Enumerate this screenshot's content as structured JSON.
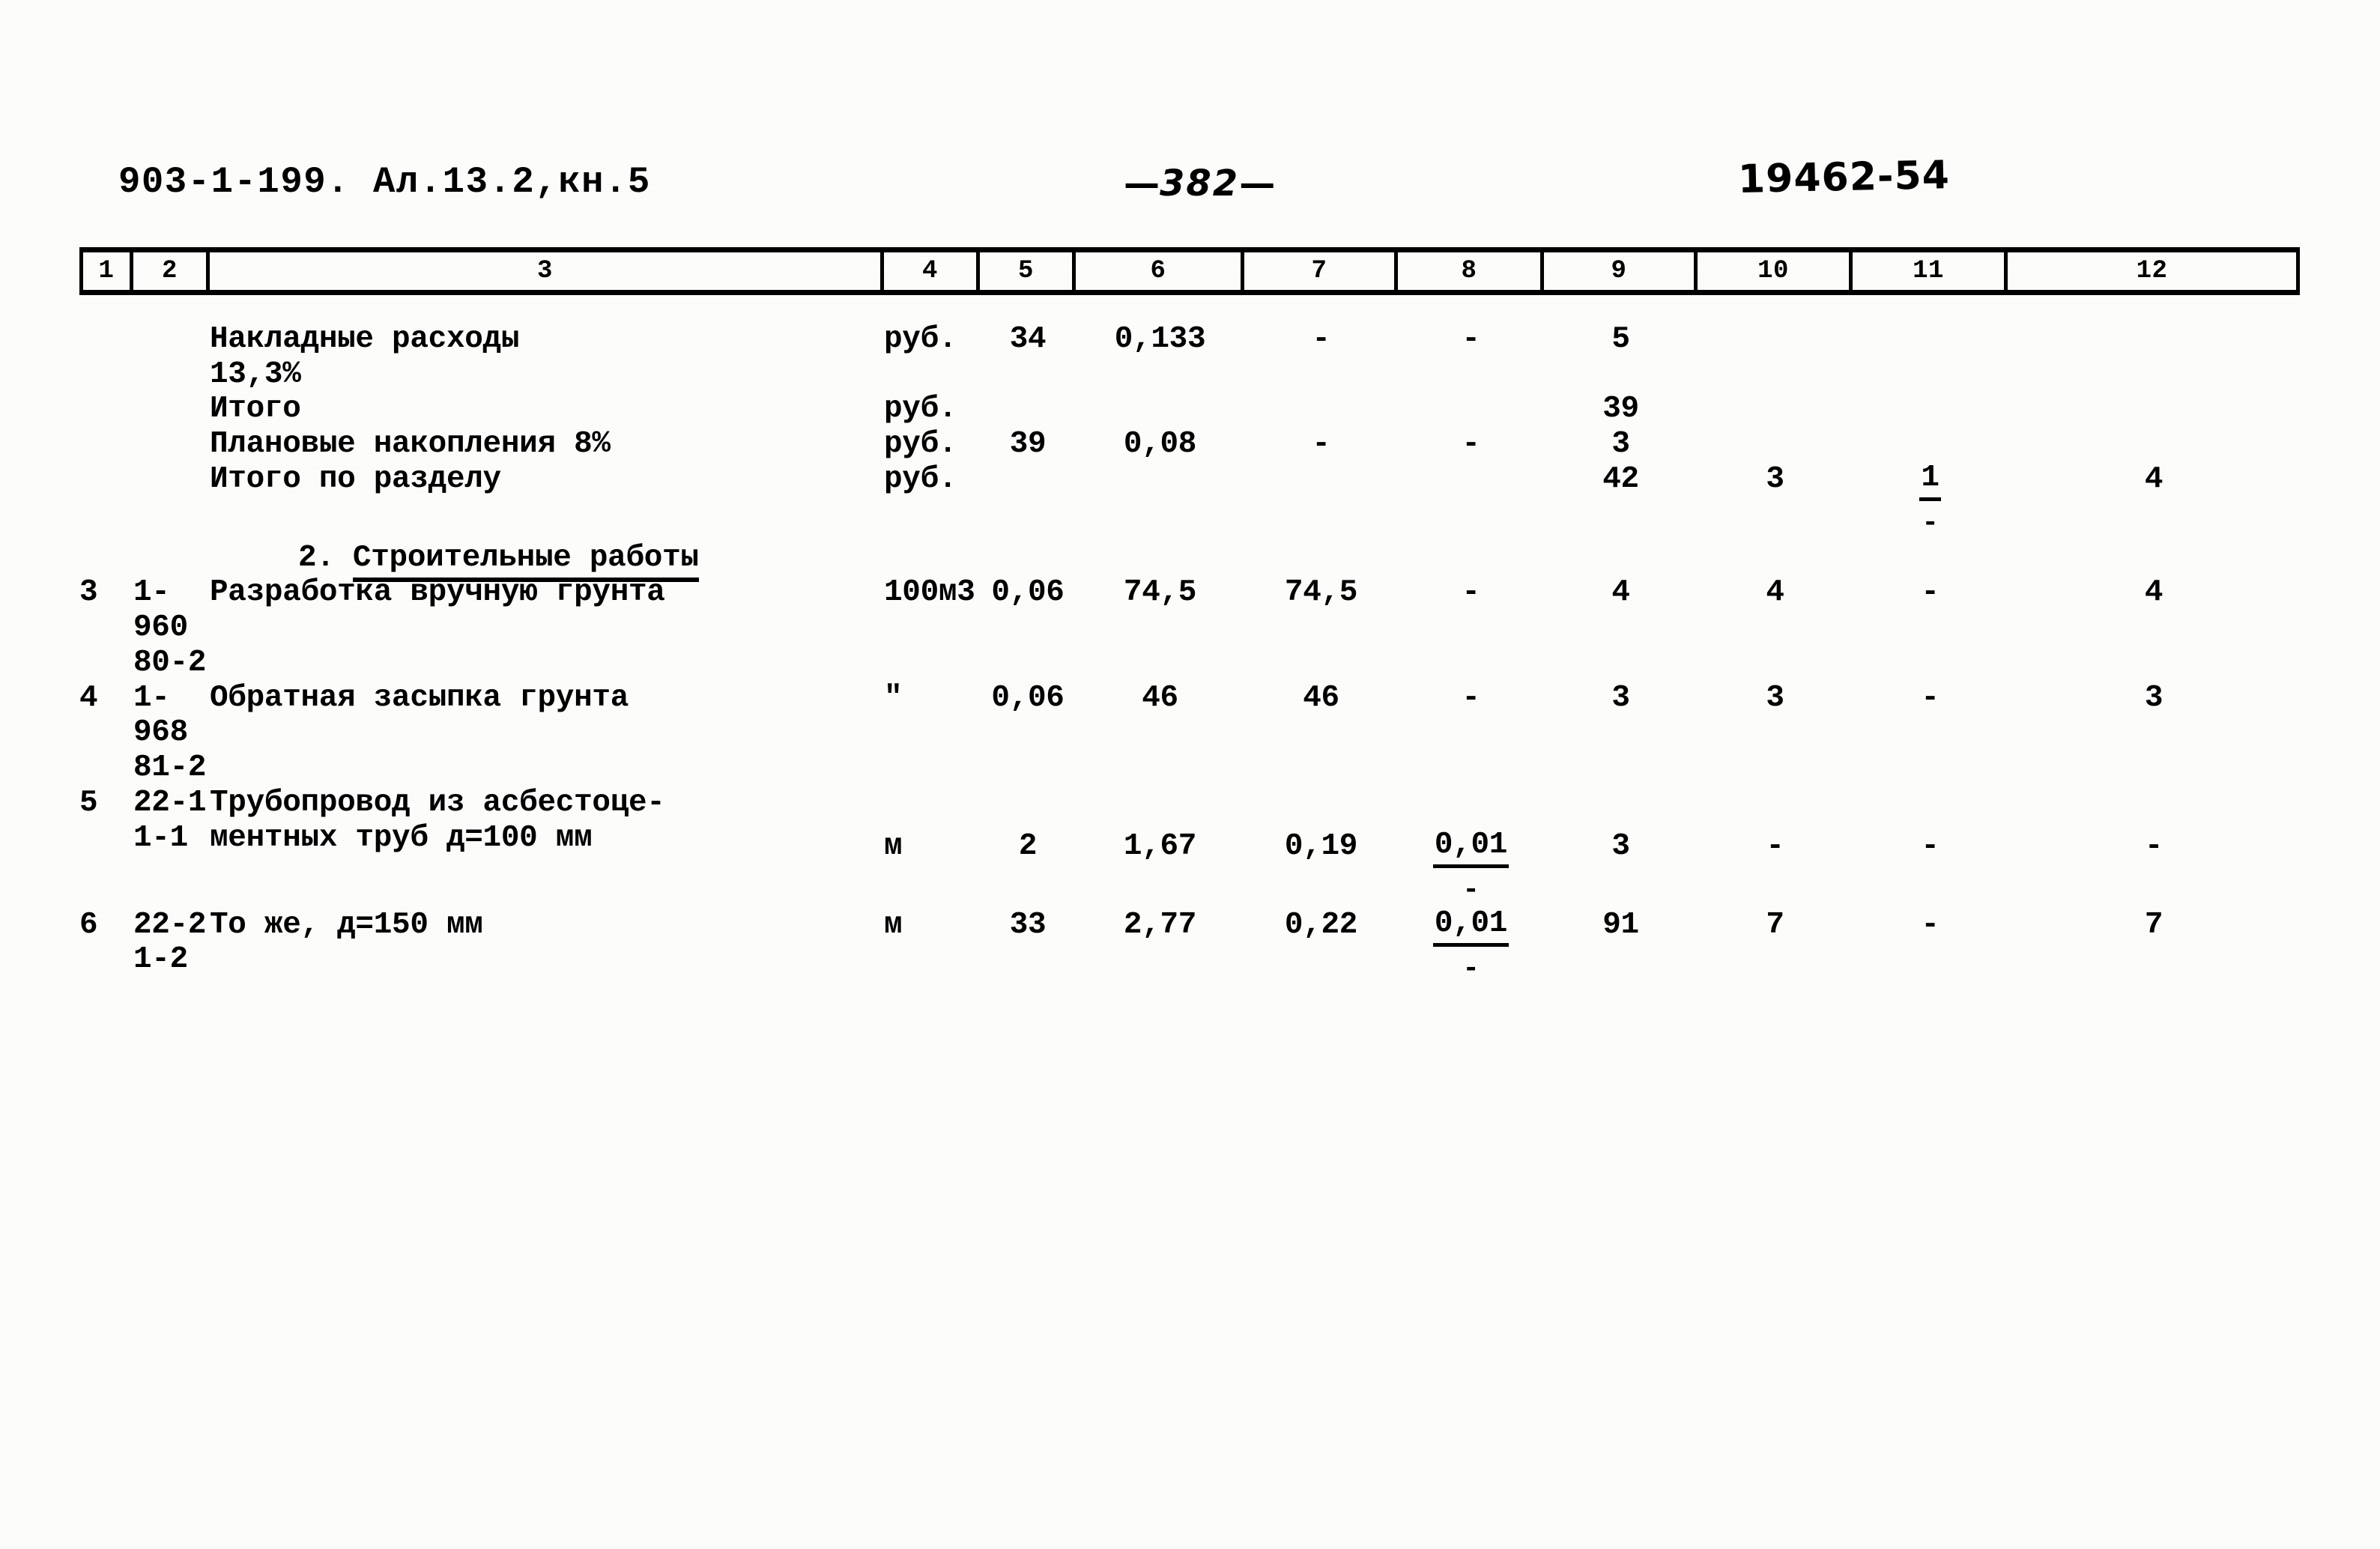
{
  "header": {
    "left": "903-1-199. Ал.13.2,кн.5",
    "page_dash_left": "—",
    "page_number": "382",
    "page_dash_right": "—",
    "right_stamp": "19462-54"
  },
  "column_numbers": [
    "1",
    "2",
    "3",
    "4",
    "5",
    "6",
    "7",
    "8",
    "9",
    "10",
    "11",
    "12"
  ],
  "section": {
    "number": "2.",
    "title": "Строительные работы"
  },
  "rows": [
    {
      "c1": "",
      "c2": "",
      "c3": "Накладные расходы\n13,3%",
      "c4": "руб.",
      "c5": "34",
      "c6": "0,133",
      "c7": "-",
      "c8": "-",
      "c9": "5",
      "c10": "",
      "c11": "",
      "c12": ""
    },
    {
      "c1": "",
      "c2": "",
      "c3": "Итого",
      "c4": "руб.",
      "c5": "",
      "c6": "",
      "c7": "",
      "c8": "",
      "c9": "39",
      "c10": "",
      "c11": "",
      "c12": ""
    },
    {
      "c1": "",
      "c2": "",
      "c3": "Плановые накопления 8%",
      "c4": "руб.",
      "c5": "39",
      "c6": "0,08",
      "c7": "-",
      "c8": "-",
      "c9": "3",
      "c10": "",
      "c11": "",
      "c12": ""
    },
    {
      "c1": "",
      "c2": "",
      "c3": "Итого по разделу",
      "c4": "руб.",
      "c5": "",
      "c6": "",
      "c7": "",
      "c8": "",
      "c9": "42",
      "c10": "3",
      "c11_fraction": {
        "top": "1",
        "bottom": "-"
      },
      "c12": "4"
    },
    {
      "c1": "3",
      "c2": "1-960\n80-2",
      "c3": "Разработка вручную грунта",
      "c4": "100м3",
      "c5": "0,06",
      "c6": "74,5",
      "c7": "74,5",
      "c8": "-",
      "c9": "4",
      "c10": "4",
      "c11": "-",
      "c12": "4"
    },
    {
      "c1": "4",
      "c2": "1-968\n81-2",
      "c3": "Обратная засыпка грунта",
      "c4": "\"",
      "c5": "0,06",
      "c6": "46",
      "c7": "46",
      "c8": "-",
      "c9": "3",
      "c10": "3",
      "c11": "-",
      "c12": "3"
    },
    {
      "c1": "5",
      "c2": "22-1\n1-1",
      "c3": "Трубопровод из асбестоце-\nментных труб д=100 мм",
      "c4": "м",
      "c5": "2",
      "c6": "1,67",
      "c7": "0,19",
      "c8_fraction": {
        "top": "0,01",
        "bottom": "-"
      },
      "c9": "3",
      "c10": "-",
      "c11": "-",
      "c12": "-"
    },
    {
      "c1": "6",
      "c2": "22-2\n1-2",
      "c3": "То же, д=150 мм",
      "c4": "м",
      "c5": "33",
      "c6": "2,77",
      "c7": "0,22",
      "c8_fraction": {
        "top": "0,01",
        "bottom": "-"
      },
      "c9": "91",
      "c10": "7",
      "c11": "-",
      "c12": "7"
    }
  ]
}
